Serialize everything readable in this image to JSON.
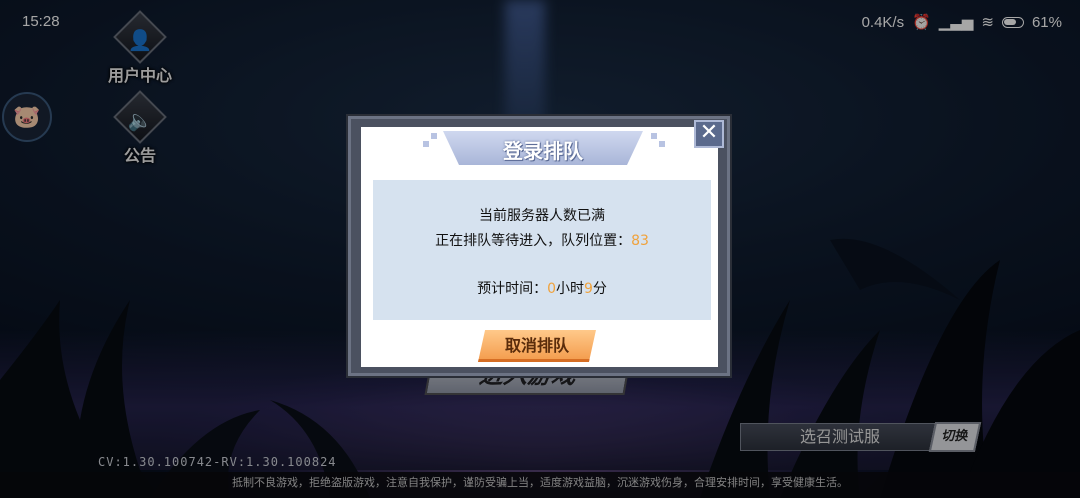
{
  "status_bar": {
    "time": "15:28",
    "network_speed": "0.4K/s",
    "battery": "61%",
    "icons": [
      "alarm-icon",
      "signal-icon",
      "wifi-icon",
      "battery-icon"
    ]
  },
  "side_menu": {
    "user_center": "用户中心",
    "notice": "公告"
  },
  "background": {
    "enter_game": "进入游戏"
  },
  "dialog": {
    "title": "登录排队",
    "close": "✕",
    "line1": "当前服务器人数已满",
    "line2_prefix": "正在排队等待进入，队列位置：",
    "queue_position": "83",
    "line3_prefix": "预计时间：",
    "hours": "0",
    "hours_unit": "小时",
    "minutes": "9",
    "minutes_unit": "分",
    "cancel": "取消排队"
  },
  "server": {
    "name": "选召测试服",
    "switch_label": "切换"
  },
  "version": "CV:1.30.100742-RV:1.30.100824",
  "footer": "抵制不良游戏，拒绝盗版游戏，注意自我保护，谨防受骗上当，适度游戏益脑，沉迷游戏伤身，合理安排时间，享受健康生活。",
  "colors": {
    "accent_orange": "#f0a23c",
    "dialog_frame": "#4b5160",
    "message_box": "#d6e2ef",
    "cancel_button": "#f39a4a"
  }
}
